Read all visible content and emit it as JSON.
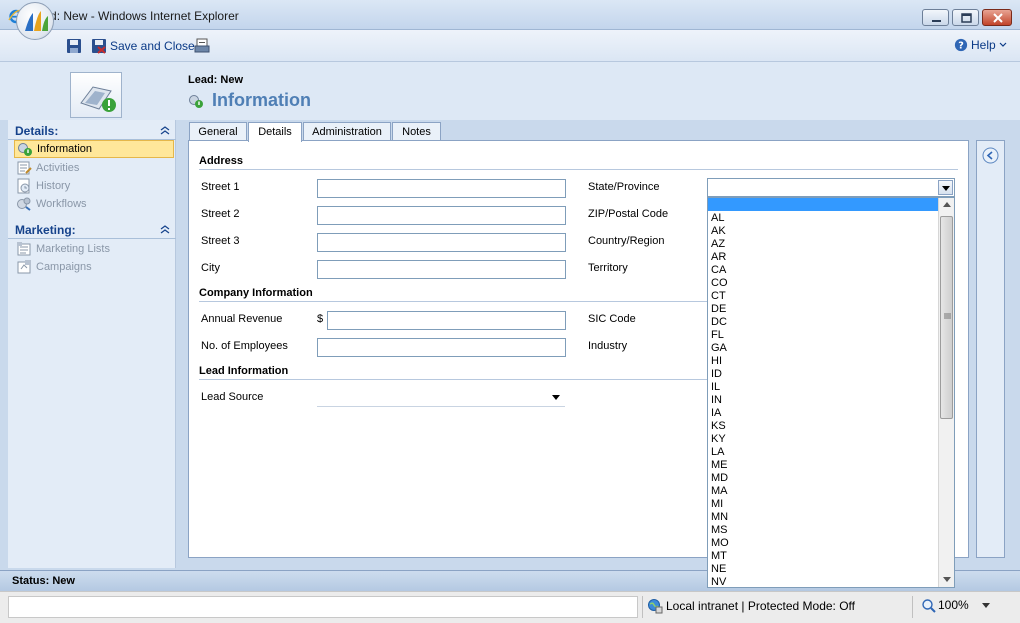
{
  "window": {
    "title": "Lead: New - Windows Internet Explorer"
  },
  "toolbar": {
    "save_close_label": "Save and Close",
    "help_label": "Help"
  },
  "header": {
    "subtitle": "Lead: New",
    "title": "Information"
  },
  "nav": {
    "details_header": "Details:",
    "details_items": [
      {
        "label": "Information",
        "icon": "information-icon",
        "selected": true
      },
      {
        "label": "Activities",
        "icon": "activities-icon",
        "selected": false
      },
      {
        "label": "History",
        "icon": "history-icon",
        "selected": false
      },
      {
        "label": "Workflows",
        "icon": "workflows-icon",
        "selected": false
      }
    ],
    "marketing_header": "Marketing:",
    "marketing_items": [
      {
        "label": "Marketing Lists",
        "icon": "marketing-lists-icon"
      },
      {
        "label": "Campaigns",
        "icon": "campaigns-icon"
      }
    ]
  },
  "tabs": [
    {
      "label": "General",
      "active": false
    },
    {
      "label": "Details",
      "active": true
    },
    {
      "label": "Administration",
      "active": false
    },
    {
      "label": "Notes",
      "active": false
    }
  ],
  "sections": {
    "address": "Address",
    "company": "Company Information",
    "lead": "Lead Information"
  },
  "fields": {
    "street1": "Street 1",
    "street2": "Street 2",
    "street3": "Street 3",
    "city": "City",
    "state": "State/Province",
    "zip": "ZIP/Postal Code",
    "country": "Country/Region",
    "territory": "Territory",
    "annual_revenue": "Annual Revenue",
    "currency_symbol": "$",
    "employees": "No. of Employees",
    "sic": "SIC Code",
    "industry": "Industry",
    "lead_source": "Lead Source"
  },
  "state_options": [
    "AL",
    "AK",
    "AZ",
    "AR",
    "CA",
    "CO",
    "CT",
    "DE",
    "DC",
    "FL",
    "GA",
    "HI",
    "ID",
    "IL",
    "IN",
    "IA",
    "KS",
    "KY",
    "LA",
    "ME",
    "MD",
    "MA",
    "MI",
    "MN",
    "MS",
    "MO",
    "MT",
    "NE",
    "NV"
  ],
  "status": {
    "text": "Status: New"
  },
  "ie_status": {
    "zone": "Local intranet | Protected Mode: Off",
    "zoom": "100%"
  },
  "colors": {
    "accent": "#4f7fb5",
    "selection": "#3399ff",
    "nav_selected": "#ffe79a"
  }
}
